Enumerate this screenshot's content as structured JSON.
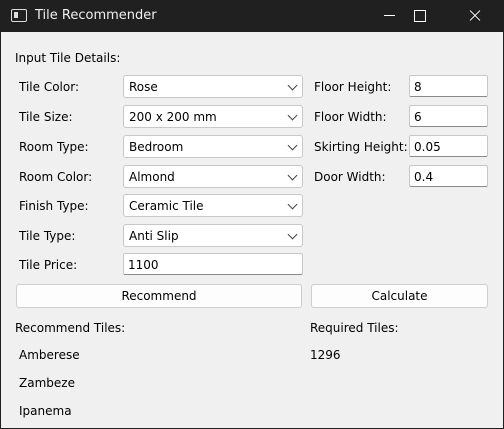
{
  "window": {
    "title": "Tile Recommender"
  },
  "form": {
    "section_label": "Input Tile Details:",
    "tile_color": {
      "label": "Tile Color:",
      "value": "Rose"
    },
    "tile_size": {
      "label": "Tile Size:",
      "value": "200 x 200 mm"
    },
    "room_type": {
      "label": "Room Type:",
      "value": "Bedroom"
    },
    "room_color": {
      "label": "Room Color:",
      "value": "Almond"
    },
    "finish_type": {
      "label": "Finish Type:",
      "value": "Ceramic Tile"
    },
    "tile_type": {
      "label": "Tile Type:",
      "value": "Anti Slip"
    },
    "tile_price": {
      "label": "Tile Price:",
      "value": "1100"
    },
    "floor_height": {
      "label": "Floor Height:",
      "value": "8"
    },
    "floor_width": {
      "label": "Floor Width:",
      "value": "6"
    },
    "skirting_height": {
      "label": "Skirting Height:",
      "value": "0.05"
    },
    "door_width": {
      "label": "Door Width:",
      "value": "0.4"
    }
  },
  "buttons": {
    "recommend": "Recommend",
    "calculate": "Calculate"
  },
  "results": {
    "recommend_label": "Recommend Tiles:",
    "tiles": [
      "Amberese",
      "Zambeze",
      "Ipanema"
    ],
    "required_label": "Required Tiles:",
    "required_value": "1296"
  }
}
